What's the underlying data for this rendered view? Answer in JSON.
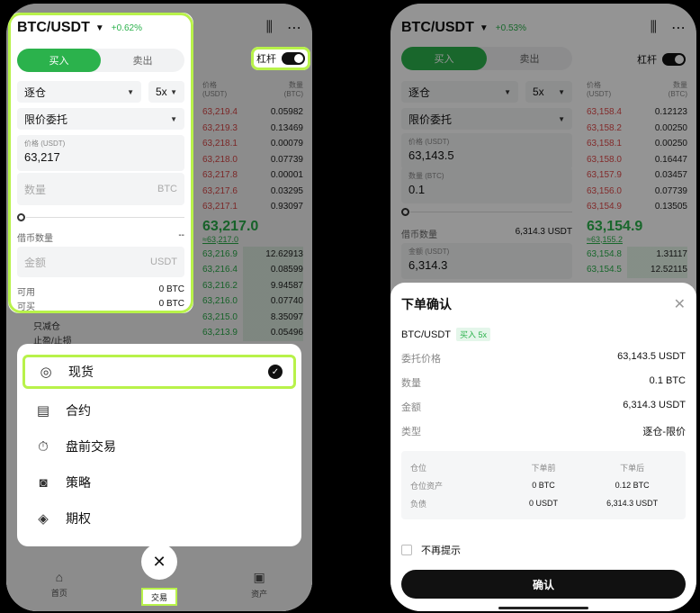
{
  "left": {
    "pair": "BTC/USDT",
    "change": "+0.62%",
    "buy_label": "买入",
    "sell_label": "卖出",
    "margin_mode": "逐仓",
    "leverage": "5x",
    "order_type": "限价委托",
    "price_label": "价格 (USDT)",
    "price_value": "63,217",
    "qty_placeholder": "数量",
    "qty_unit": "BTC",
    "borrow_label": "借币数量",
    "borrow_value": "--",
    "amount_placeholder": "金额",
    "amount_unit": "USDT",
    "avail_label": "可用",
    "avail_value": "0 BTC",
    "sellable_label": "可买",
    "sellable_value": "0 BTC",
    "lev_label": "杠杆",
    "book": {
      "h_price": "价格\n(USDT)",
      "h_amount": "数量\n(BTC)",
      "asks": [
        {
          "p": "63,219.4",
          "a": "0.05982"
        },
        {
          "p": "63,219.3",
          "a": "0.13469"
        },
        {
          "p": "63,218.1",
          "a": "0.00079"
        },
        {
          "p": "63,218.0",
          "a": "0.07739"
        },
        {
          "p": "63,217.8",
          "a": "0.00001"
        },
        {
          "p": "63,217.6",
          "a": "0.03295"
        },
        {
          "p": "63,217.1",
          "a": "0.93097"
        }
      ],
      "mid": "63,217.0",
      "mid_sub": "≈63,217.0",
      "bids": [
        {
          "p": "63,216.9",
          "a": "12.62913"
        },
        {
          "p": "63,216.4",
          "a": "0.08599"
        },
        {
          "p": "63,216.2",
          "a": "9.94587"
        },
        {
          "p": "63,216.0",
          "a": "0.07740"
        },
        {
          "p": "63,215.0",
          "a": "8.35097"
        },
        {
          "p": "63,213.9",
          "a": "0.05496"
        }
      ]
    },
    "peek1": "只减仓",
    "peek2": "止盈/止损",
    "menu": [
      {
        "icon": "◎",
        "label": "现货"
      },
      {
        "icon": "▤",
        "label": "合约"
      },
      {
        "icon": "⏱",
        "label": "盘前交易"
      },
      {
        "icon": "◙",
        "label": "策略"
      },
      {
        "icon": "◈",
        "label": "期权"
      }
    ],
    "tab_home": "首页",
    "tab_trade": "交易",
    "tab_assets": "资产",
    "fab_icon": "✕"
  },
  "right": {
    "pair": "BTC/USDT",
    "change": "+0.53%",
    "buy_label": "买入",
    "sell_label": "卖出",
    "margin_mode": "逐仓",
    "leverage": "5x",
    "order_type": "限价委托",
    "price_label": "价格 (USDT)",
    "price_value": "63,143.5",
    "qty_label": "数量 (BTC)",
    "qty_value": "0.1",
    "borrow_label": "借币数量",
    "borrow_value": "6,314.3 USDT",
    "amount_label": "金额 (USDT)",
    "amount_value": "6,314.3",
    "lev_label": "杠杆",
    "book": {
      "h_price": "价格\n(USDT)",
      "h_amount": "数量\n(BTC)",
      "asks": [
        {
          "p": "63,158.4",
          "a": "0.12123"
        },
        {
          "p": "63,158.2",
          "a": "0.00250"
        },
        {
          "p": "63,158.1",
          "a": "0.00250"
        },
        {
          "p": "63,158.0",
          "a": "0.16447"
        },
        {
          "p": "63,157.9",
          "a": "0.03457"
        },
        {
          "p": "63,156.0",
          "a": "0.07739"
        },
        {
          "p": "63,154.9",
          "a": "0.13505"
        }
      ],
      "mid": "63,154.9",
      "mid_sub": "≈63,155.2",
      "bids": [
        {
          "p": "63,154.8",
          "a": "1.31117"
        },
        {
          "p": "63,154.5",
          "a": "12.52115"
        }
      ]
    },
    "sheet": {
      "title": "下单确认",
      "close": "✕",
      "pair": "BTC/USDT",
      "tag": "买入 5x",
      "rows": [
        {
          "k": "委托价格",
          "v": "63,143.5 USDT"
        },
        {
          "k": "数量",
          "v": "0.1 BTC"
        },
        {
          "k": "金额",
          "v": "6,314.3 USDT"
        },
        {
          "k": "类型",
          "v": "逐仓-限价"
        }
      ],
      "pos_head": [
        "仓位",
        "下单前",
        "下单后"
      ],
      "pos_rows": [
        [
          "仓位资产",
          "0 BTC",
          "0.12 BTC"
        ],
        [
          "负债",
          "0 USDT",
          "6,314.3 USDT"
        ]
      ],
      "no_remind": "不再提示",
      "confirm": "确认"
    }
  }
}
